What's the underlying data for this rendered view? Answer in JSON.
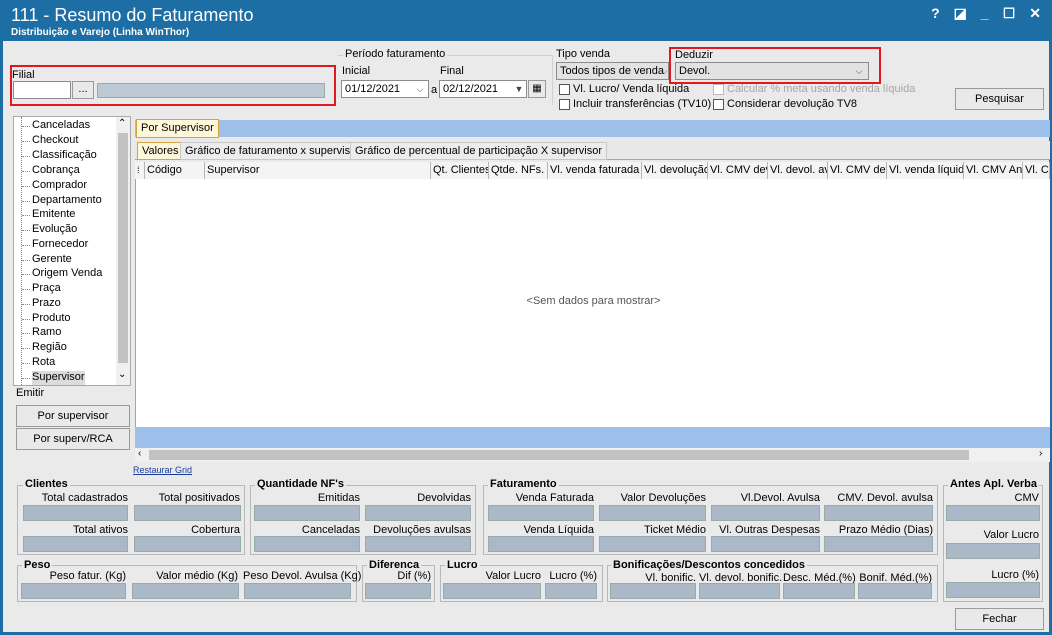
{
  "window": {
    "title": "111 - Resumo do Faturamento",
    "subtitle": "Distribuição e Varejo (Linha WinThor)",
    "controls": [
      "?",
      "◪",
      "_",
      "☐",
      "✕"
    ]
  },
  "filial": {
    "label": "Filial",
    "code_value": "",
    "lookup_label": "...",
    "name_value": ""
  },
  "periodo": {
    "group_label": "Período faturamento",
    "inicial_label": "Inicial",
    "inicial_value": "01/12/2021",
    "sep_label": "a",
    "final_label": "Final",
    "final_value": "02/12/2021"
  },
  "tipo_venda": {
    "label": "Tipo venda",
    "value": "Todos tipos de venda",
    "chk_lucro_label": "Vl. Lucro/ Venda líquida",
    "chk_transf_label": "Incluir transferências  (TV10)"
  },
  "deduzir": {
    "label": "Deduzir",
    "value": "Devol.",
    "chk_meta_label": "Calcular % meta usando venda líquida",
    "chk_devol_label": "Considerar devolução TV8"
  },
  "pesquisar_label": "Pesquisar",
  "tree": {
    "items": [
      "Canceladas",
      "Checkout",
      "Classificação",
      "Cobrança",
      "Comprador",
      "Departamento",
      "Emitente",
      "Evolução",
      "Fornecedor",
      "Gerente",
      "Origem Venda",
      "Praça",
      "Prazo",
      "Produto",
      "Ramo",
      "Região",
      "Rota",
      "Supervisor"
    ]
  },
  "emitir": {
    "label": "Emitir",
    "btn_supervisor": "Por supervisor",
    "btn_superv_rca": "Por superv/RCA"
  },
  "tabs": {
    "main": "Por Supervisor",
    "sub": [
      "Valores",
      "Gráfico de faturamento x supervisor",
      "Gráfico de percentual de participação X supervisor"
    ]
  },
  "grid": {
    "columns": [
      "Código",
      "Supervisor",
      "Qt. Clientes",
      "Qtde. NFs.",
      "Vl. venda faturada",
      "Vl. devolução",
      "Vl. CMV devo",
      "Vl. devol. av",
      "Vl. CMV dev",
      "Vl. venda líquida",
      "Vl. CMV Ante",
      "Vl. Cl"
    ],
    "empty_text": "<Sem dados para mostrar>",
    "restaurar_label": "Restaurar Grid"
  },
  "summary": {
    "clientes": {
      "title": "Clientes",
      "labels": [
        "Total cadastrados",
        "Total positivados",
        "Total ativos",
        "Cobertura"
      ]
    },
    "qtd_nfs": {
      "title": "Quantidade NF's",
      "labels": [
        "Emitidas",
        "Devolvidas",
        "Canceladas",
        "Devoluções avulsas"
      ]
    },
    "faturamento": {
      "title": "Faturamento",
      "labels": [
        "Venda Faturada",
        "Valor Devoluções",
        "Vl.Devol. Avulsa",
        "CMV. Devol. avulsa",
        "Venda Líquida",
        "Ticket Médio",
        "Vl. Outras Despesas",
        "Prazo Médio (Dias)"
      ]
    },
    "antes": {
      "title": "Antes Apl. Verba",
      "labels": [
        "CMV",
        "Valor Lucro",
        "Lucro (%)"
      ]
    },
    "peso": {
      "title": "Peso",
      "labels": [
        "Peso fatur. (Kg)",
        "Valor médio (Kg)",
        "Peso Devol. Avulsa (Kg)"
      ]
    },
    "diferenca": {
      "title": "Diferenca",
      "labels": [
        "Dif (%)"
      ]
    },
    "lucro": {
      "title": "Lucro",
      "labels": [
        "Valor Lucro",
        "Lucro (%)"
      ]
    },
    "bonif": {
      "title": "Bonificações/Descontos concedidos",
      "labels": [
        "Vl. bonific.",
        "Vl. devol. bonific.",
        "Desc. Méd.(%)",
        "Bonif. Méd.(%)"
      ]
    }
  },
  "fechar_label": "Fechar"
}
